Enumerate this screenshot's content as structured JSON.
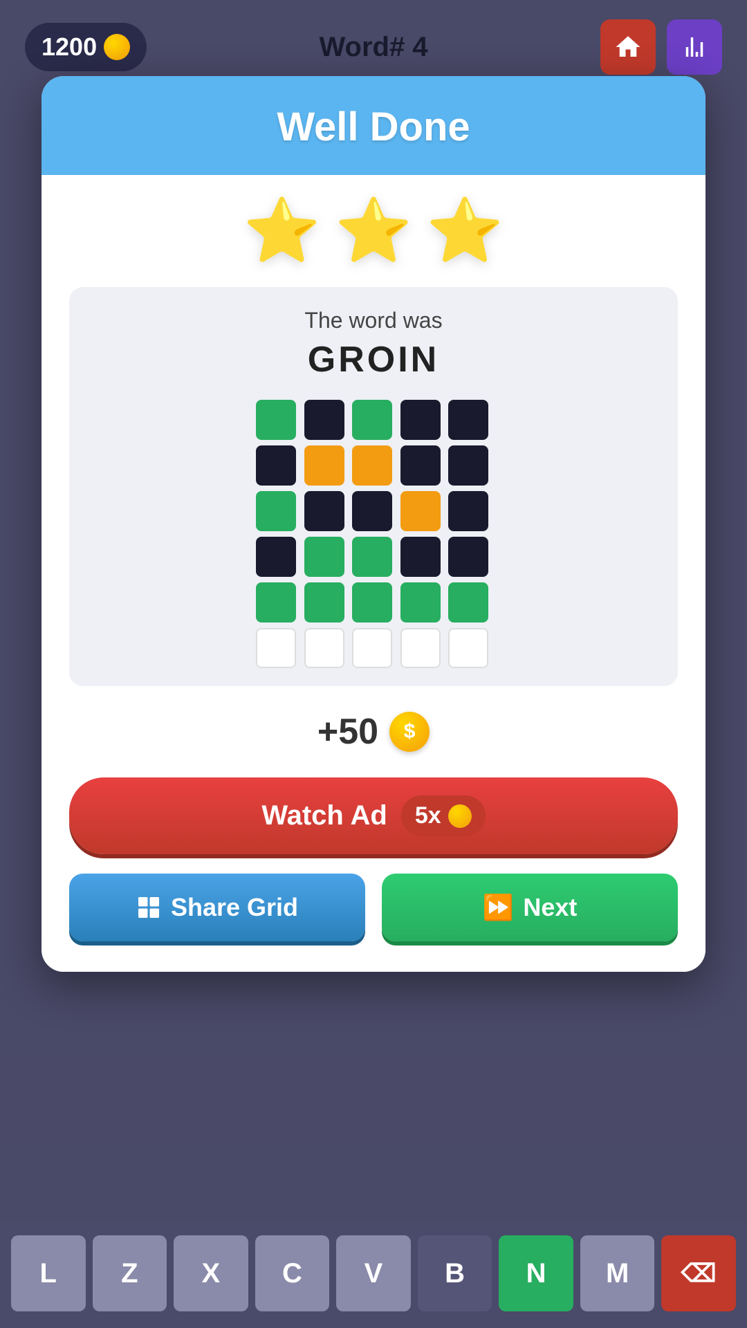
{
  "topbar": {
    "coins": "1200",
    "title": "Word# 4",
    "home_btn_label": "Home",
    "stats_btn_label": "Stats"
  },
  "modal": {
    "header_title": "Well Done",
    "stars_count": 3,
    "word_label": "The word was",
    "word_answer": "GROIN",
    "reward_text": "+50",
    "watch_ad_label": "Watch Ad",
    "watch_ad_multiplier": "5x",
    "share_label": "Share Grid",
    "next_label": "Next"
  },
  "grid": {
    "rows": [
      [
        "green",
        "black",
        "green",
        "black",
        "black"
      ],
      [
        "black",
        "orange",
        "orange",
        "black",
        "black"
      ],
      [
        "green",
        "black",
        "black",
        "orange",
        "black"
      ],
      [
        "black",
        "green",
        "green",
        "black",
        "black"
      ],
      [
        "green",
        "green",
        "green",
        "green",
        "green"
      ],
      [
        "white",
        "white",
        "white",
        "white",
        "white"
      ]
    ]
  },
  "keyboard": {
    "keys": [
      "L",
      "Z",
      "X",
      "C",
      "V",
      "B",
      "N",
      "M",
      "⌫"
    ]
  }
}
